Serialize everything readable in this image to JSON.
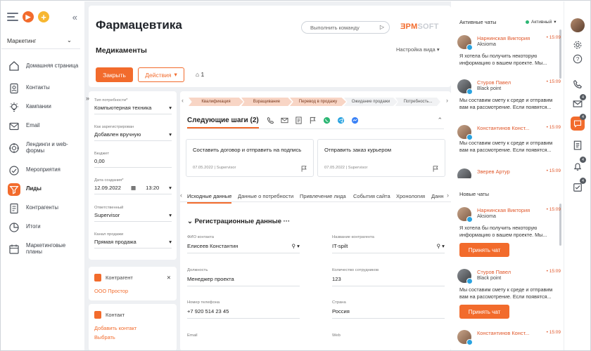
{
  "sidebar": {
    "workspace": "Маркетинг",
    "items": [
      {
        "label": "Домашняя страница",
        "icon": "home-icon"
      },
      {
        "label": "Контакты",
        "icon": "contact-icon"
      },
      {
        "label": "Кампании",
        "icon": "campaign-icon"
      },
      {
        "label": "Email",
        "icon": "email-icon"
      },
      {
        "label": "Лендинги и web-формы",
        "icon": "landing-icon"
      },
      {
        "label": "Мероприятия",
        "icon": "events-icon"
      },
      {
        "label": "Лиды",
        "icon": "leads-icon",
        "active": true
      },
      {
        "label": "Контрагенты",
        "icon": "accounts-icon"
      },
      {
        "label": "Итоги",
        "icon": "dashboard-icon"
      },
      {
        "label": "Маркетинговые планы",
        "icon": "calendar-icon"
      }
    ]
  },
  "header": {
    "title": "Фармацевтика",
    "command_placeholder": "Выполнить команду",
    "logo_a": "ƎPM",
    "logo_b": "SOFT",
    "subtitle": "Медикаменты",
    "view_settings": "Настройка вида",
    "save_label": "Закрыть",
    "actions_label": "Действия",
    "tag_count": "1"
  },
  "fields": [
    {
      "label": "Тип потребности*",
      "value": "Компьютерная техника"
    },
    {
      "label": "Как зарегистрирован",
      "value": "Добавлен вручную"
    },
    {
      "label": "Бюджет",
      "value": "0,00"
    },
    {
      "label": "Дата создания*",
      "value": "12.09.2022",
      "time": "13:20"
    },
    {
      "label": "Ответственный",
      "value": "Supervisor"
    },
    {
      "label": "Канал продажи",
      "value": "Прямая продажа"
    }
  ],
  "account_card": {
    "title": "Контрагент",
    "link": "ООО Простор"
  },
  "contact_card": {
    "title": "Контакт",
    "link": "Добавить контакт",
    "link2": "Выбрать"
  },
  "stages": [
    "Квалификация",
    "Взращивание",
    "Перевод в продажу",
    "Ожидание продажи",
    "Потребность..."
  ],
  "next_steps": {
    "title": "Следующие шаги (2)",
    "tasks": [
      {
        "text": "Составить договор и отправить на подпись",
        "date": "07.05.2022",
        "owner": "Supervisor"
      },
      {
        "text": "Отправить заказ курьером",
        "date": "07.05.2022",
        "owner": "Supervisor"
      }
    ]
  },
  "tabs": [
    "Исходные данные",
    "Данные о потребности",
    "Привлечение лида",
    "События сайта",
    "Хронология",
    "Данн"
  ],
  "registration": {
    "title": "Регистрационные данные",
    "fields": [
      {
        "label": "ФИО контакта",
        "value": "Елисеев Константин"
      },
      {
        "label": "Название контрагента",
        "value": "IT-spilt"
      },
      {
        "label": "Должность",
        "value": "Менеджер проекта"
      },
      {
        "label": "Количество сотрудников",
        "value": "123"
      },
      {
        "label": "Номер телефона",
        "value": "+7 920 514 23 45"
      },
      {
        "label": "Страна",
        "value": "Россия"
      },
      {
        "label": "Email",
        "value": ""
      },
      {
        "label": "Web",
        "value": ""
      }
    ]
  },
  "chats": {
    "active_title": "Активные чаты",
    "status": "Активный",
    "active": [
      {
        "name": "Нарнинская Виктория",
        "time": "• 15:09",
        "company": "Aksioma",
        "message": "Я хотела бы получить некоторую информацию о вашем проекте. Мы..."
      },
      {
        "name": "Стуров Павел",
        "time": "• 15:09",
        "company": "Black point",
        "message": "Мы составим смету к среде и отправим вам на рассмотрение. Если появятся..."
      },
      {
        "name": "Константинов Конст...",
        "time": "• 15:09",
        "company": "",
        "message": "Мы составим смету к среде и отправим вам на рассмотрение. Если появятся..."
      },
      {
        "name": "Зверев Артур",
        "time": "• 15:09",
        "company": "",
        "message": ""
      }
    ],
    "new_title": "Новые чаты",
    "new": [
      {
        "name": "Нарнинская Виктория",
        "time": "• 15:09",
        "company": "Aksioma",
        "message": "Я хотела бы получить некоторую информацию о вашем проекте. Мы...",
        "accept": "Принять чат"
      },
      {
        "name": "Стуров Павел",
        "time": "• 15:09",
        "company": "Black point",
        "message": "Мы составим смету к среде и отправим вам на рассмотрение. Если появятся...",
        "accept": "Принять чат"
      },
      {
        "name": "Константинов Конст...",
        "time": "• 15:09",
        "company": "",
        "message": "",
        "accept": ""
      }
    ]
  },
  "rail_badges": [
    "4",
    "4",
    "4",
    "4"
  ],
  "colors": {
    "accent": "#f26b2c",
    "link": "#e0572a",
    "online": "#2bb673"
  }
}
